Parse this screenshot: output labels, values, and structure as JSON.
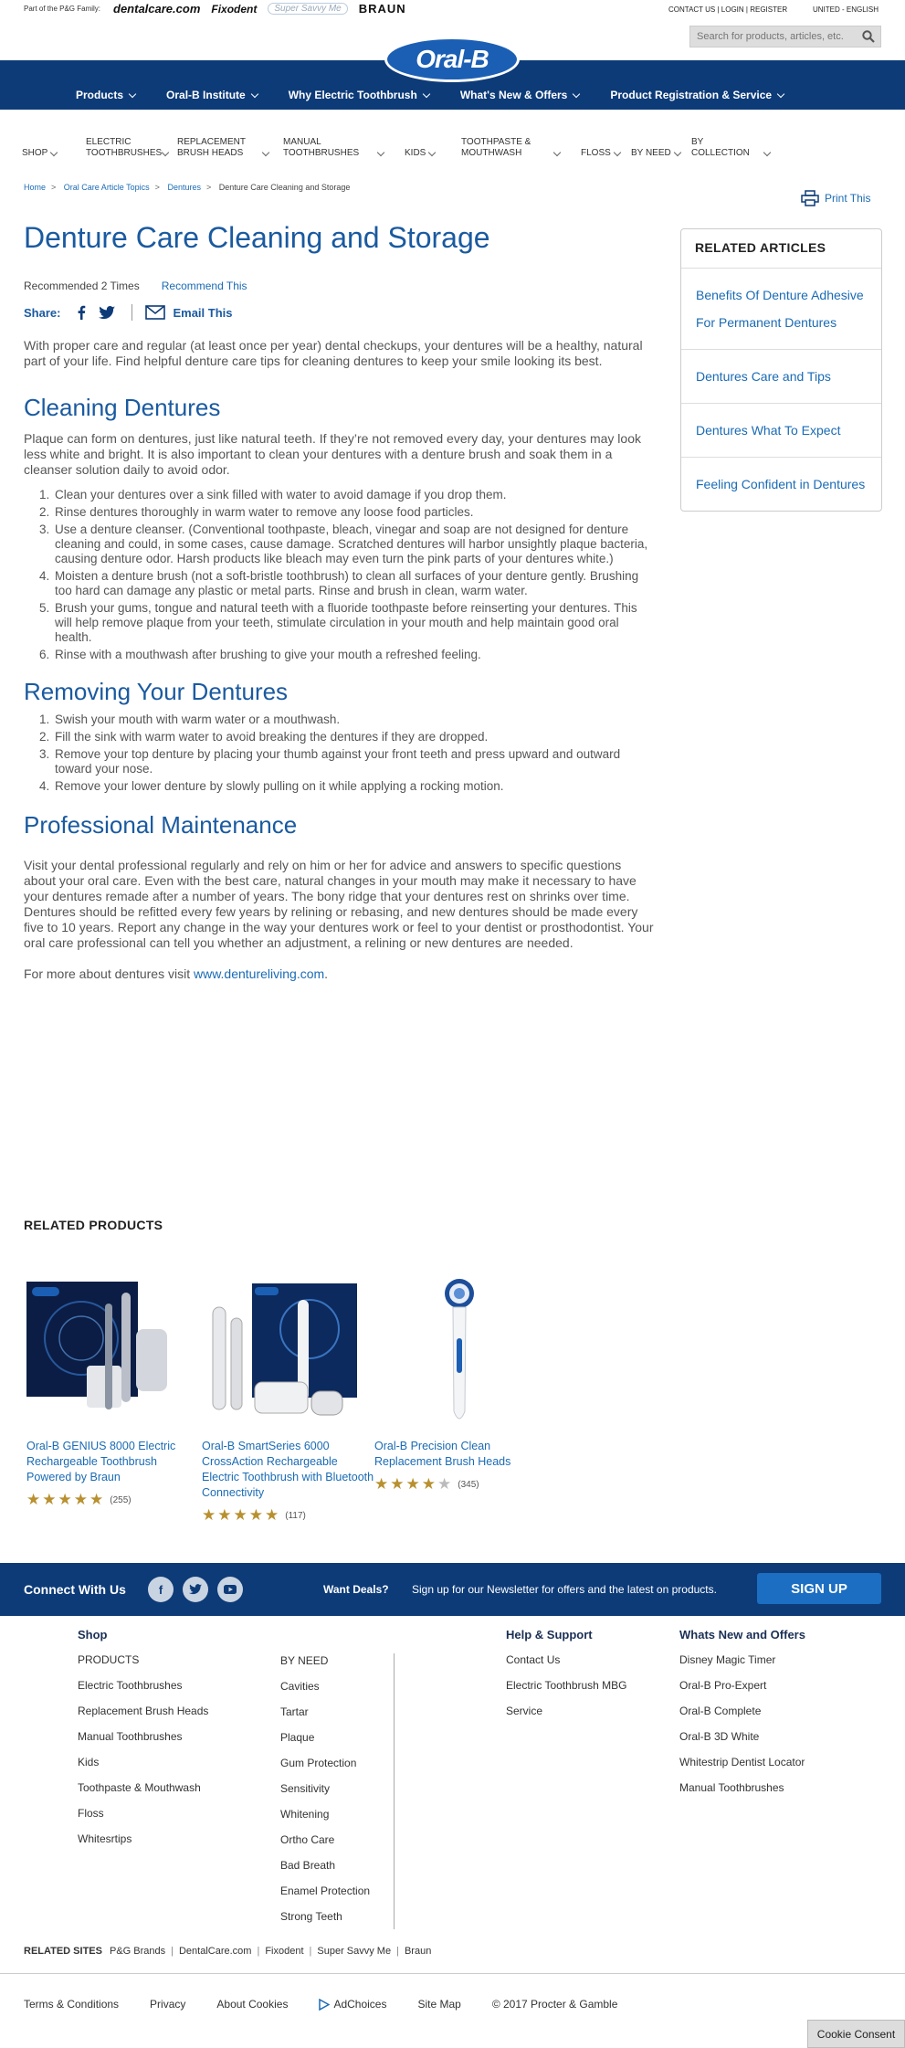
{
  "topbar": {
    "family_text": "Part of the P&G Family:",
    "brands": [
      "dentalcare.com",
      "Fixodent",
      "Super Savvy Me",
      "BRAUN"
    ],
    "util_links": "CONTACT US | LOGIN | REGISTER",
    "region": "UNITED - ENGLISH",
    "search_placeholder": "Search for products, articles, etc."
  },
  "logo": "Oral-B",
  "main_nav": [
    "Products",
    "Oral-B Institute",
    "Why Electric Toothbrush",
    "What's New & Offers",
    "Product Registration & Service"
  ],
  "sub_nav": [
    "SHOP",
    "ELECTRIC TOOTHBRUSHES",
    "REPLACEMENT BRUSH HEADS",
    "MANUAL TOOTHBRUSHES",
    "KIDS",
    "TOOTHPASTE & MOUTHWASH",
    "FLOSS",
    "BY NEED",
    "BY COLLECTION"
  ],
  "breadcrumb": [
    "Home",
    "Oral Care Article Topics",
    "Dentures",
    "Denture Care Cleaning and Storage"
  ],
  "print_label": "Print This",
  "article": {
    "title": "Denture Care Cleaning and Storage",
    "recommended": "Recommended 2 Times",
    "recommend_link": "Recommend This",
    "share_label": "Share:",
    "email_label": "Email This",
    "intro": "With proper care and regular (at least once per year) dental checkups, your dentures will be a healthy, natural part of your life. Find helpful denture care tips for cleaning dentures to keep your smile looking its best.",
    "section1_title": "Cleaning Dentures",
    "section1_intro": "Plaque can form on dentures, just like natural teeth. If they’re not removed every day, your dentures may look less white and bright. It is also important to clean your dentures with a denture brush and soak them in a cleanser solution daily to avoid odor.",
    "section1_steps": [
      "Clean your dentures over a sink filled with water to avoid damage if you drop them.",
      "Rinse dentures thoroughly in warm water to remove any loose food particles.",
      "Use a denture cleanser. (Conventional toothpaste, bleach, vinegar and soap are not designed for denture cleaning and could, in some cases, cause damage. Scratched dentures will harbor unsightly plaque bacteria, causing denture odor. Harsh products like bleach may even turn the pink parts of your dentures white.)",
      "Moisten a denture brush (not a soft-bristle toothbrush) to clean all surfaces of your denture gently. Brushing too hard can damage any plastic or metal parts. Rinse and brush in clean, warm water.",
      "Brush your gums, tongue and natural teeth with a fluoride toothpaste before reinserting your dentures. This will help remove plaque from your teeth, stimulate circulation in your mouth and help maintain good oral health.",
      "Rinse with a mouthwash after brushing to give your mouth a refreshed feeling."
    ],
    "section2_title": "Removing Your Dentures",
    "section2_steps": [
      "Swish your mouth with warm water or a mouthwash.",
      "Fill the sink with warm water to avoid breaking the dentures if they are dropped.",
      "Remove your top denture by placing your thumb against your front teeth and press upward and outward toward your nose.",
      "Remove your lower denture by slowly pulling on it while applying a rocking motion."
    ],
    "section3_title": "Professional Maintenance",
    "section3_body": "Visit your dental professional regularly and rely on him or her for advice and answers to specific questions about your oral care. Even with the best care, natural changes in your mouth may make it necessary to have your dentures remade after a number of years. The bony ridge that your dentures rest on shrinks over time. Dentures should be refitted every few years by relining or rebasing, and new dentures should be made every five to 10 years. Report any change in the way your dentures work or feel to your dentist or prosthodontist. Your oral care professional can tell you whether an adjustment, a relining or new dentures are needed.",
    "more_prefix": "For more about dentures visit ",
    "more_link": "www.dentureliving.com",
    "more_suffix": "."
  },
  "sidebar": {
    "title": "RELATED ARTICLES",
    "articles": [
      "Benefits Of Denture Adhesive For Permanent Dentures",
      "Dentures Care and Tips",
      "Dentures What To Expect",
      "Feeling Confident in Dentures"
    ]
  },
  "related_products": {
    "title": "RELATED PRODUCTS",
    "items": [
      {
        "name": "Oral-B GENIUS 8000 Electric Rechargeable Toothbrush Powered by Braun",
        "rating": 5,
        "count": "(255)"
      },
      {
        "name": "Oral-B SmartSeries 6000 CrossAction Rechargeable Electric Toothbrush with Bluetooth Connectivity",
        "rating": 5,
        "count": "(117)"
      },
      {
        "name": "Oral-B Precision Clean Replacement Brush Heads",
        "rating": 4,
        "count": "(345)"
      }
    ]
  },
  "connect": {
    "title": "Connect With Us",
    "deals": "Want Deals?",
    "newsletter": "Sign up for our Newsletter for offers and the latest on products.",
    "signup": "SIGN UP"
  },
  "footer": {
    "shop_title": "Shop",
    "shop_products": [
      "PRODUCTS",
      "Electric Toothbrushes",
      "Replacement Brush Heads",
      "Manual Toothbrushes",
      "Kids",
      "Toothpaste & Mouthwash",
      "Floss",
      "Whitesrtips"
    ],
    "shop_need": [
      "BY NEED",
      "Cavities",
      "Tartar",
      "Plaque",
      "Gum Protection",
      "Sensitivity",
      "Whitening",
      "Ortho Care",
      "Bad Breath",
      "Enamel Protection",
      "Strong Teeth"
    ],
    "help_title": "Help & Support",
    "help_items": [
      "Contact Us",
      "Electric Toothbrush MBG",
      "Service"
    ],
    "new_title": "Whats New and Offers",
    "new_items": [
      "Disney Magic Timer",
      "Oral-B Pro-Expert",
      "Oral-B Complete",
      "Oral-B 3D White",
      "Whitestrip Dentist Locator",
      "Manual Toothbrushes"
    ],
    "related_sites_label": "RELATED SITES",
    "related_sites": [
      "P&G Brands",
      "DentalCare.com",
      "Fixodent",
      "Super Savvy Me",
      "Braun"
    ],
    "legal": [
      "Terms & Conditions",
      "Privacy",
      "About Cookies",
      "AdChoices",
      "Site Map",
      "© 2017 Procter & Gamble"
    ],
    "cookie": "Cookie Consent"
  },
  "colors": {
    "brand_blue": "#0d3b78",
    "link_blue": "#1a6bb5",
    "heading_blue": "#1a5aa0",
    "star_gold": "#b8902f"
  }
}
